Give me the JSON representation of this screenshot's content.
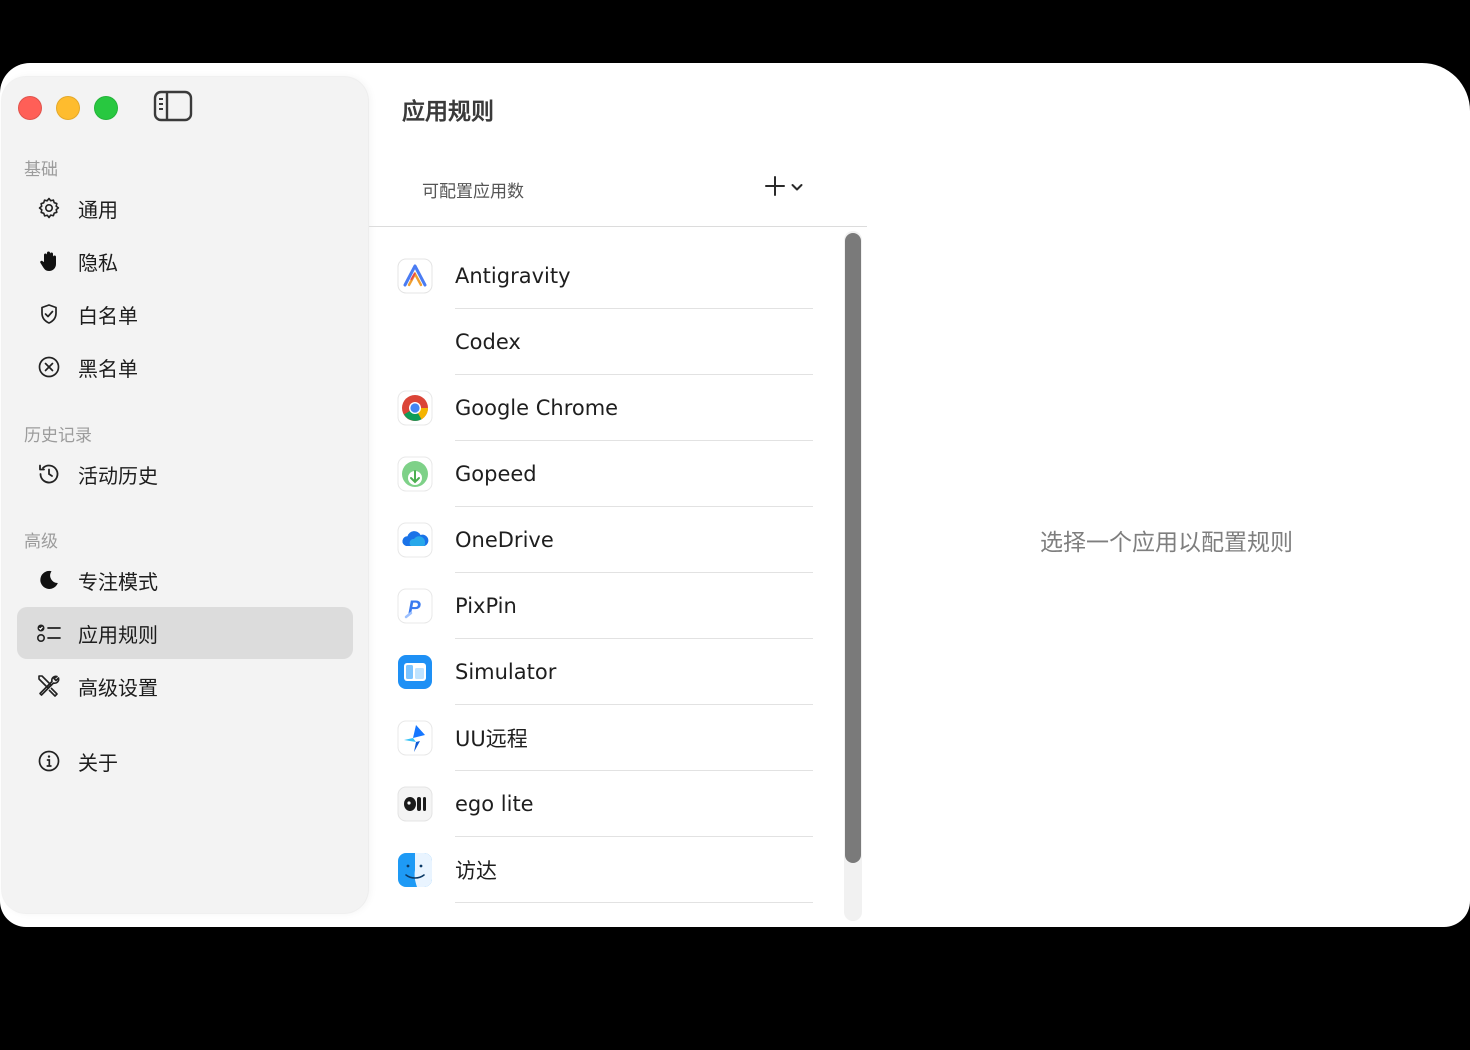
{
  "sidebar": {
    "sections": [
      {
        "title": "基础"
      },
      {
        "title": "历史记录"
      },
      {
        "title": "高级"
      }
    ],
    "items": [
      {
        "label": "通用",
        "icon": "gear-icon"
      },
      {
        "label": "隐私",
        "icon": "hand-icon"
      },
      {
        "label": "白名单",
        "icon": "shield-check-icon"
      },
      {
        "label": "黑名单",
        "icon": "x-circle-icon"
      },
      {
        "label": "活动历史",
        "icon": "history-clock-icon"
      },
      {
        "label": "专注模式",
        "icon": "moon-icon"
      },
      {
        "label": "应用规则",
        "icon": "checklist-icon",
        "selected": true
      },
      {
        "label": "高级设置",
        "icon": "tools-icon"
      },
      {
        "label": "关于",
        "icon": "info-icon"
      }
    ]
  },
  "main": {
    "title": "应用规则",
    "list_header": "可配置应用数",
    "apps": [
      {
        "name": "Antigravity",
        "icon": "antigravity-icon"
      },
      {
        "name": "Codex",
        "icon": ""
      },
      {
        "name": "Google Chrome",
        "icon": "chrome-icon"
      },
      {
        "name": "Gopeed",
        "icon": "gopeed-icon"
      },
      {
        "name": "OneDrive",
        "icon": "onedrive-icon"
      },
      {
        "name": "PixPin",
        "icon": "pixpin-icon"
      },
      {
        "name": "Simulator",
        "icon": "simulator-icon"
      },
      {
        "name": "UU远程",
        "icon": "uu-remote-icon"
      },
      {
        "name": "ego lite",
        "icon": "ego-lite-icon"
      },
      {
        "name": "访达",
        "icon": "finder-icon"
      }
    ]
  },
  "detail": {
    "empty_message": "选择一个应用以配置规则"
  },
  "colors": {
    "close": "#ff5f57",
    "minimize": "#febc2e",
    "maximize": "#28c840",
    "selected_item": "#dcdcdc"
  }
}
